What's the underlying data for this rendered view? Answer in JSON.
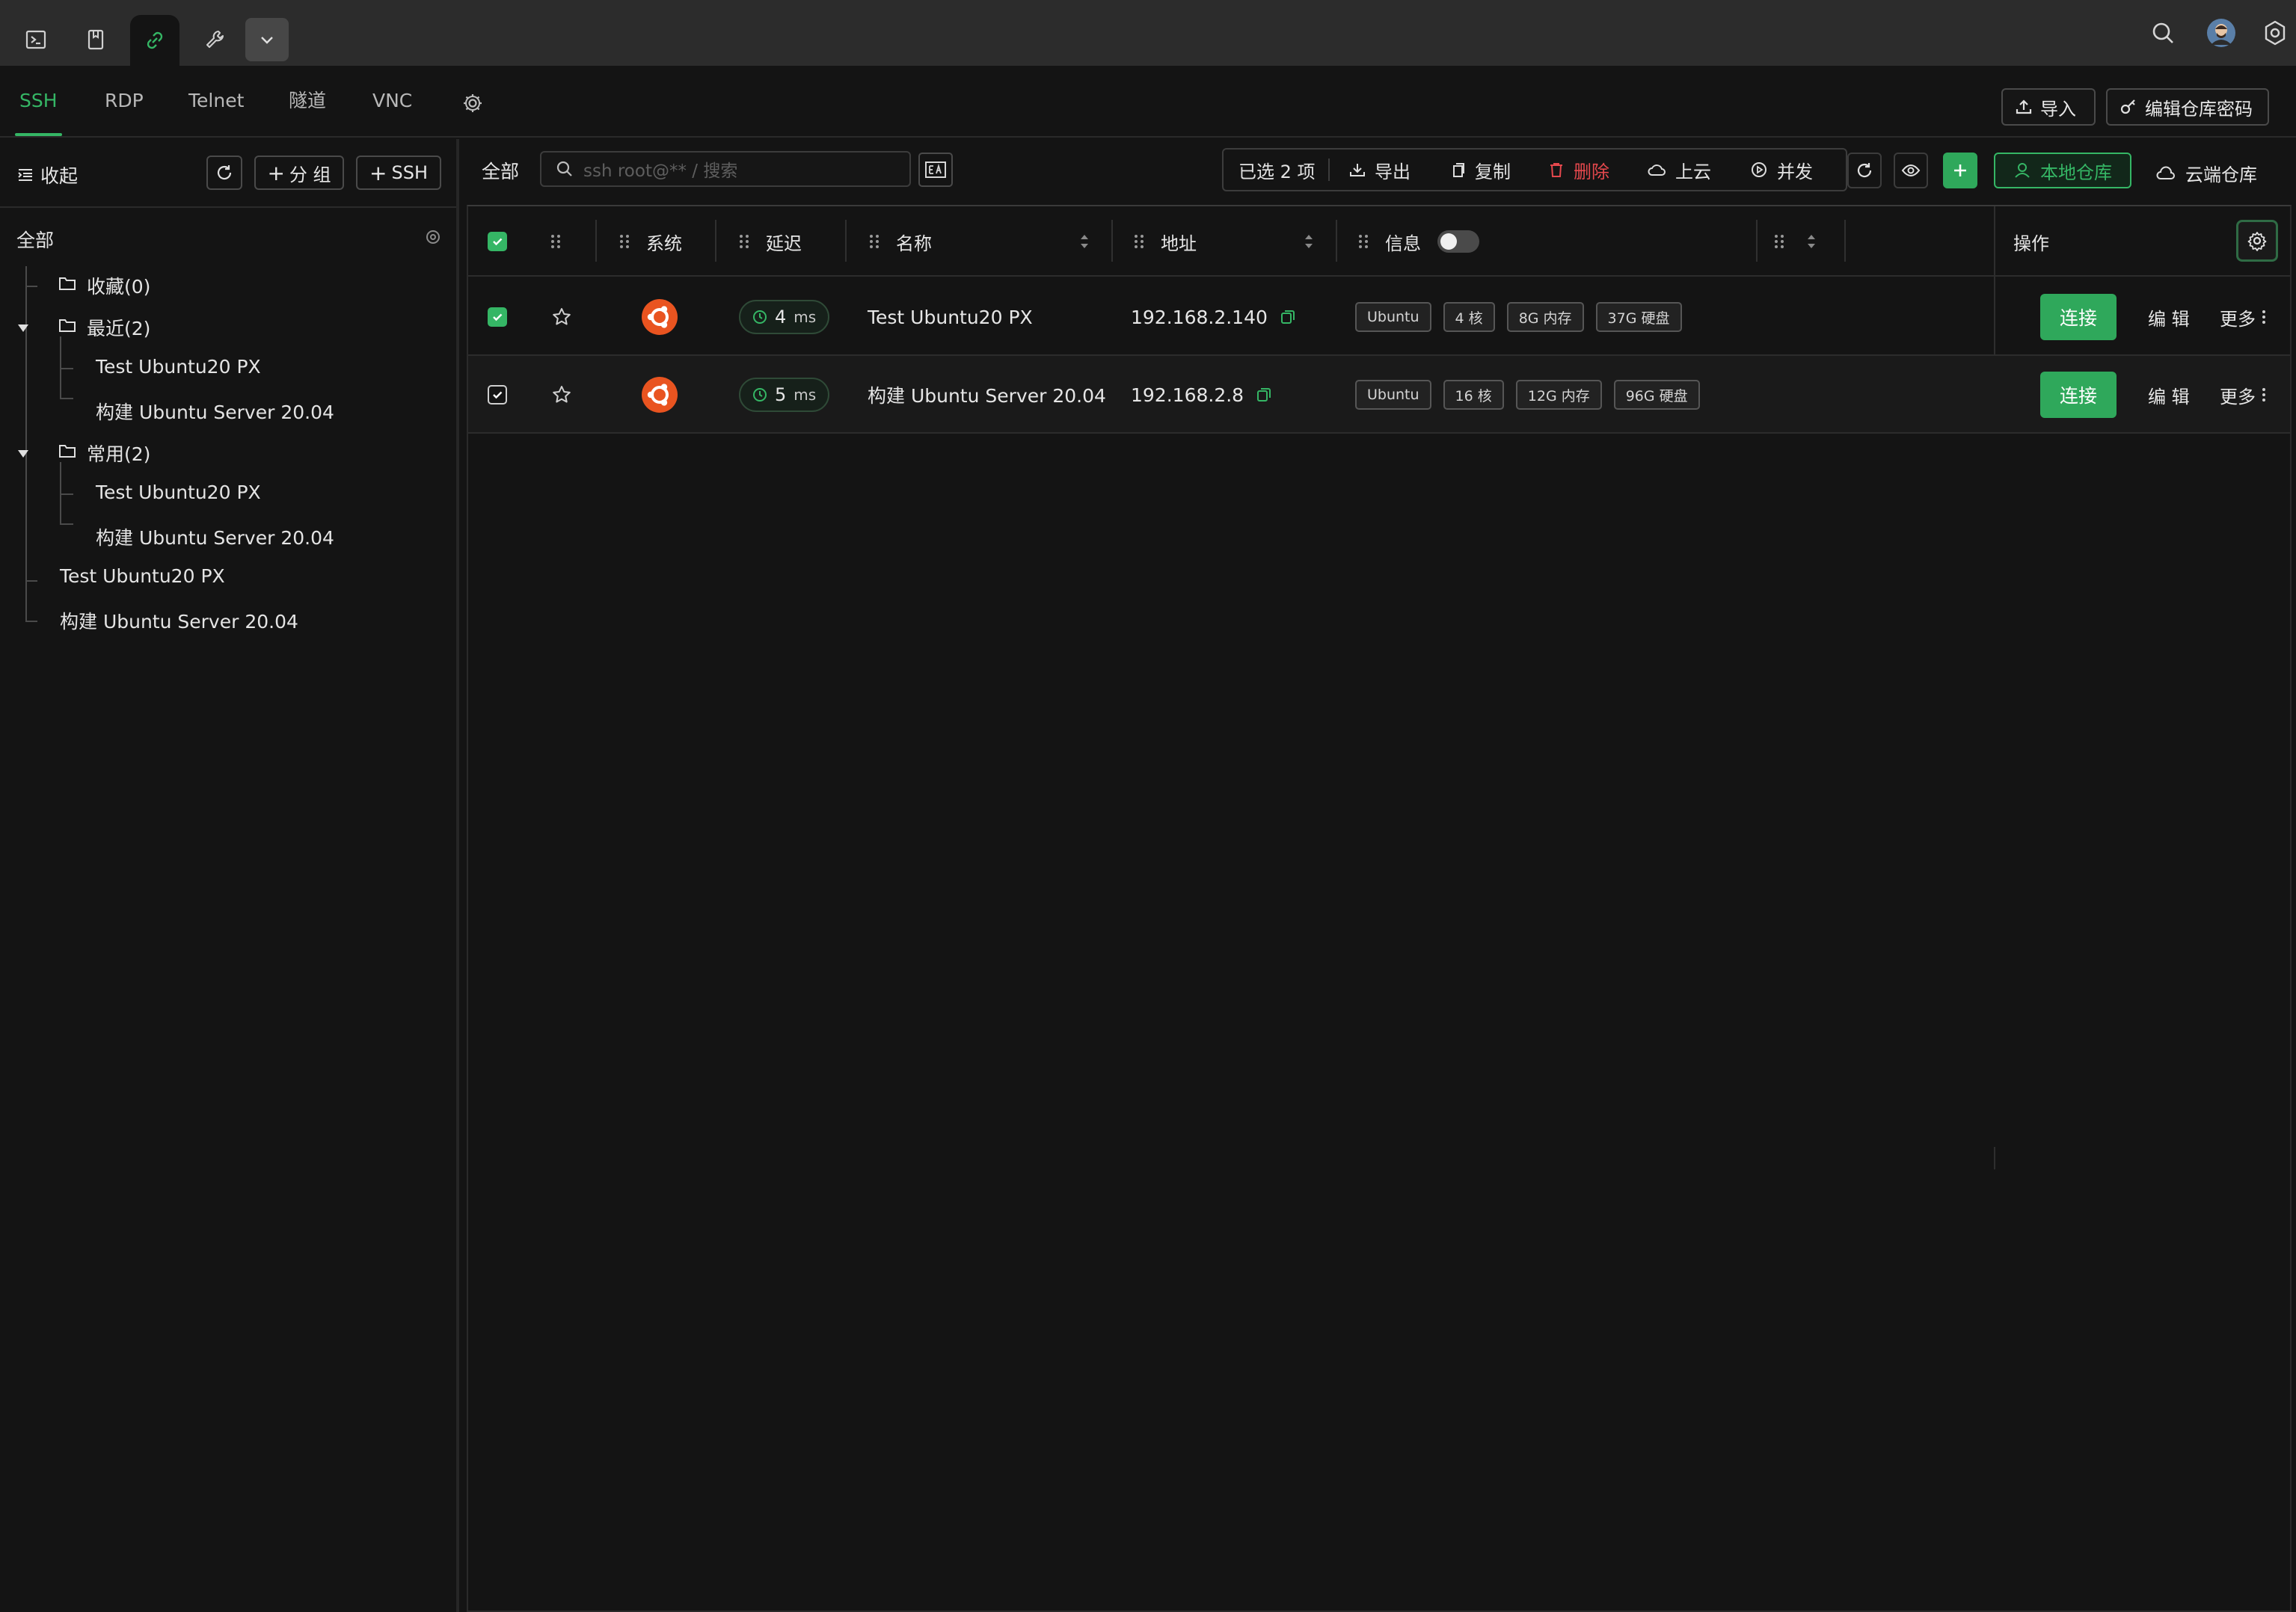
{
  "titlebar": {
    "icons": [
      "terminal-icon",
      "bookmark-icon",
      "link-icon",
      "wrench-icon",
      "chevron-down-icon",
      "search-icon",
      "avatar",
      "settings-icon"
    ]
  },
  "tabs": [
    {
      "label": "SSH",
      "active": true
    },
    {
      "label": "RDP",
      "active": false
    },
    {
      "label": "Telnet",
      "active": false
    },
    {
      "label": "隧道",
      "active": false
    },
    {
      "label": "VNC",
      "active": false
    }
  ],
  "top_actions": {
    "import_label": "导入",
    "edit_password_label": "编辑仓库密码"
  },
  "sidebar": {
    "collapse_label": "收起",
    "add_group_label": "分 组",
    "add_ssh_label": "SSH",
    "root_label": "全部",
    "tree": {
      "favorites": "收藏(0)",
      "recent": "最近(2)",
      "recent_children": [
        "Test Ubuntu20 PX",
        "构建 Ubuntu Server 20.04"
      ],
      "common": "常用(2)",
      "common_children": [
        "Test Ubuntu20 PX",
        "构建 Ubuntu Server 20.04"
      ],
      "loose": [
        "Test Ubuntu20 PX",
        "构建 Ubuntu Server 20.04"
      ]
    }
  },
  "toolbar": {
    "all_label": "全部",
    "search_placeholder": "ssh root@** / 搜索",
    "selected_label": "已选 2 项",
    "export_label": "导出",
    "copy_label": "复制",
    "delete_label": "删除",
    "upload_label": "上云",
    "concurrent_label": "并发",
    "local_repo_label": "本地仓库",
    "cloud_repo_label": "云端仓库"
  },
  "table": {
    "headers": {
      "system": "系统",
      "latency": "延迟",
      "name": "名称",
      "address": "地址",
      "info": "信息",
      "actions": "操作"
    },
    "rows": [
      {
        "latency": "4",
        "latency_unit": "ms",
        "name": "Test Ubuntu20 PX",
        "address": "192.168.2.140",
        "tags": [
          "Ubuntu",
          "4 核",
          "8G 内存",
          "37G 硬盘"
        ],
        "connect": "连接",
        "edit": "编 辑",
        "more": "更多"
      },
      {
        "latency": "5",
        "latency_unit": "ms",
        "name": "构建 Ubuntu Server 20.04",
        "address": "192.168.2.8",
        "tags": [
          "Ubuntu",
          "16 核",
          "12G 内存",
          "96G 硬盘"
        ],
        "connect": "连接",
        "edit": "编 辑",
        "more": "更多"
      }
    ]
  },
  "colors": {
    "accent": "#35b665",
    "danger": "#e5484d",
    "ubuntu": "#e95420"
  }
}
